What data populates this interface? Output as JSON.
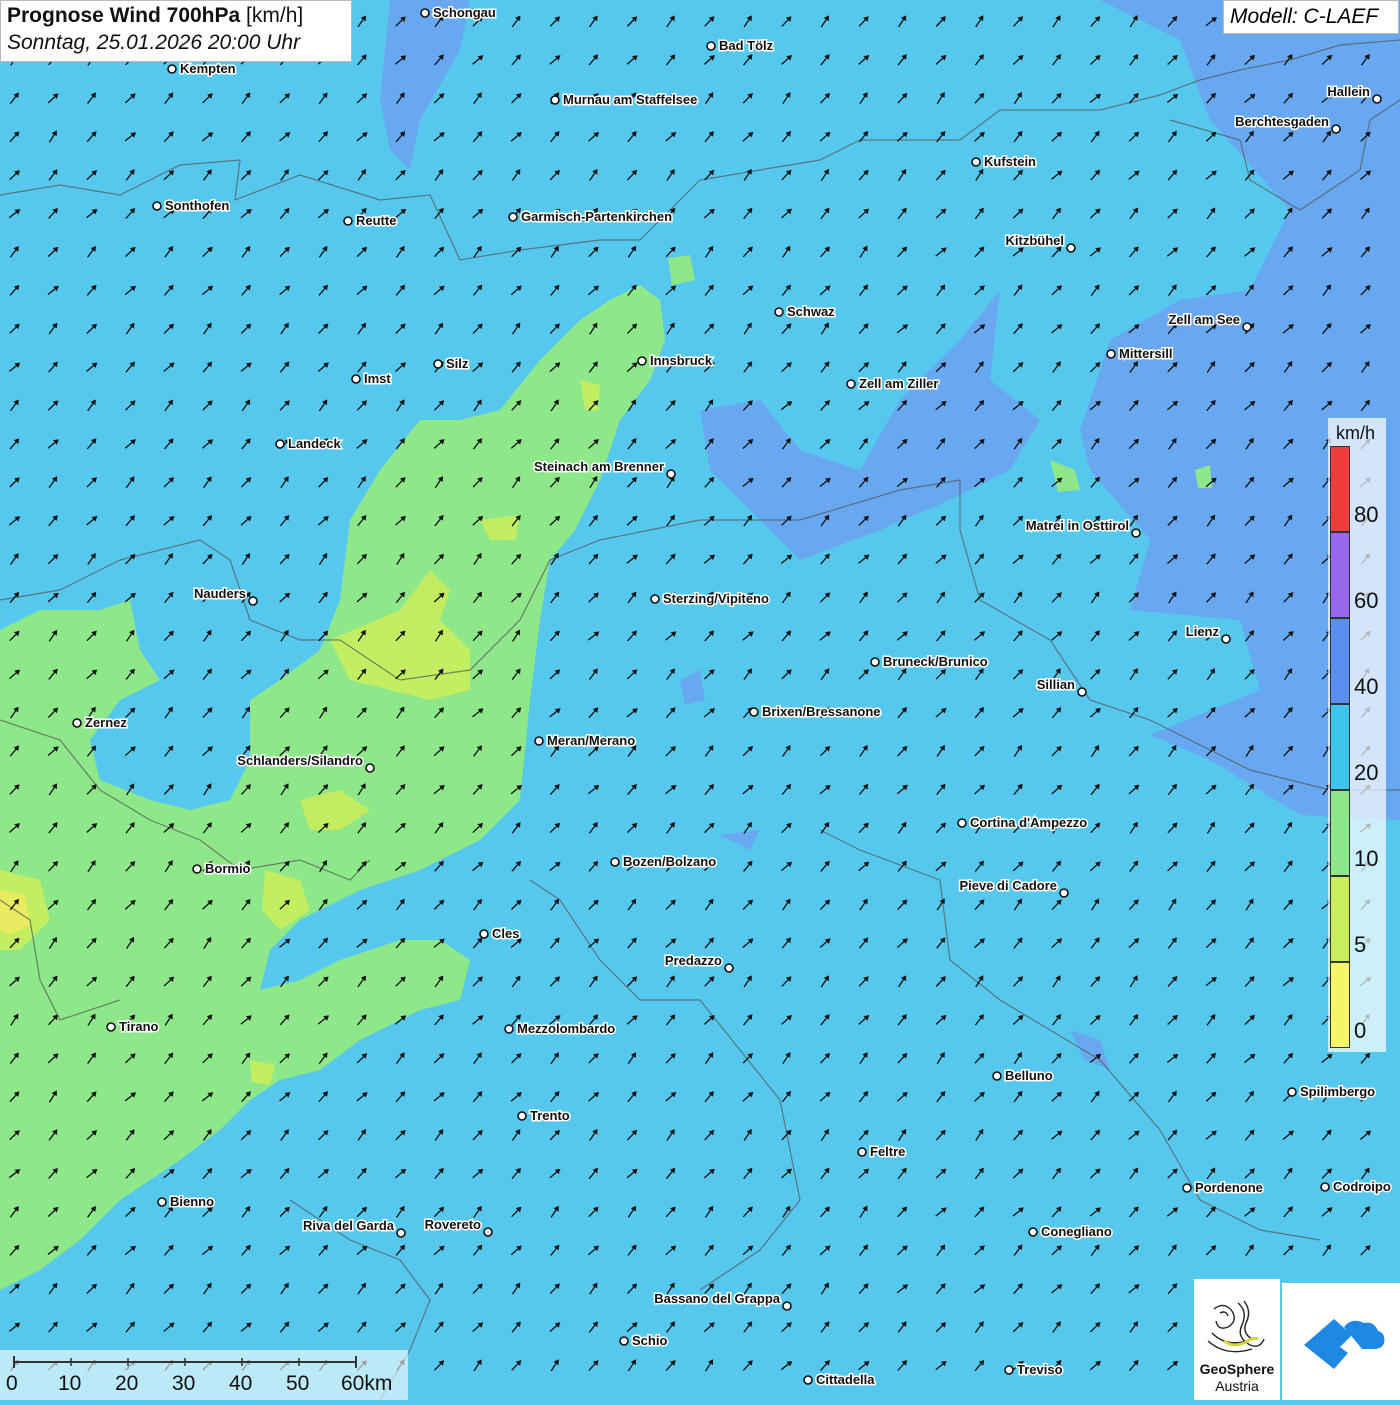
{
  "header": {
    "title_bold": "Prognose Wind 700hPa",
    "title_unit": "[km/h]",
    "datetime": "Sonntag, 25.01.2026 20:00 Uhr",
    "model": "Modell: C-LAEF"
  },
  "legend": {
    "unit": "km/h",
    "classes": [
      {
        "from": 0,
        "to": 5,
        "color": "#f5f56a"
      },
      {
        "from": 5,
        "to": 10,
        "color": "#c8ee5e"
      },
      {
        "from": 10,
        "to": 20,
        "color": "#8ee889"
      },
      {
        "from": 20,
        "to": 40,
        "color": "#3fc4ee"
      },
      {
        "from": 40,
        "to": 60,
        "color": "#5a8ff0"
      },
      {
        "from": 60,
        "to": 80,
        "color": "#9666ec"
      },
      {
        "from": 80,
        "to": null,
        "color": "#f03b3b"
      }
    ],
    "ticks": [
      "0",
      "5",
      "10",
      "20",
      "40",
      "60",
      "80"
    ]
  },
  "scale_bar": {
    "labels": [
      "0",
      "10",
      "20",
      "30",
      "40",
      "50",
      "60km"
    ]
  },
  "logos": {
    "geosphere_line1": "GeoSphere",
    "geosphere_line2": "Austria",
    "geosphere_icon": "geosphere-logo-icon",
    "app_icon": "cloud-arrow-logo-icon"
  },
  "wind_arrows": {
    "direction": "north-east",
    "color": "#111111"
  },
  "cities": [
    {
      "name": "Schongau"
    },
    {
      "name": "Bad Tölz"
    },
    {
      "name": "Kempten"
    },
    {
      "name": "Murnau am Staffelsee"
    },
    {
      "name": "Hallein"
    },
    {
      "name": "Berchtesgaden"
    },
    {
      "name": "Kufstein"
    },
    {
      "name": "Sonthofen"
    },
    {
      "name": "Reutte"
    },
    {
      "name": "Garmisch-Partenkirchen"
    },
    {
      "name": "Kitzbühel"
    },
    {
      "name": "Schwaz"
    },
    {
      "name": "Zell am See"
    },
    {
      "name": "Innsbruck"
    },
    {
      "name": "Mittersill"
    },
    {
      "name": "Silz"
    },
    {
      "name": "Imst"
    },
    {
      "name": "Zell am Ziller"
    },
    {
      "name": "Landeck"
    },
    {
      "name": "Steinach am Brenner"
    },
    {
      "name": "Matrei in Osttirol"
    },
    {
      "name": "Nauders"
    },
    {
      "name": "Sterzing/Vipiteno"
    },
    {
      "name": "Lienz"
    },
    {
      "name": "Bruneck/Brunico"
    },
    {
      "name": "Sillian"
    },
    {
      "name": "Zernez"
    },
    {
      "name": "Brixen/Bressanone"
    },
    {
      "name": "Meran/Merano"
    },
    {
      "name": "Schlanders/Silandro"
    },
    {
      "name": "Cortina d'Ampezzo"
    },
    {
      "name": "Bozen/Bolzano"
    },
    {
      "name": "Bormio"
    },
    {
      "name": "Pieve di Cadore"
    },
    {
      "name": "Cles"
    },
    {
      "name": "Predazzo"
    },
    {
      "name": "Tirano"
    },
    {
      "name": "Mezzolombardo"
    },
    {
      "name": "Belluno"
    },
    {
      "name": "Spilimbergo"
    },
    {
      "name": "Trento"
    },
    {
      "name": "Feltre"
    },
    {
      "name": "Pordenone"
    },
    {
      "name": "Codroipo"
    },
    {
      "name": "Bienno"
    },
    {
      "name": "Riva del Garda"
    },
    {
      "name": "Rovereto"
    },
    {
      "name": "Conegliano"
    },
    {
      "name": "Bassano del Grappa"
    },
    {
      "name": "Schio"
    },
    {
      "name": "Treviso"
    },
    {
      "name": "Cittadella"
    }
  ]
}
